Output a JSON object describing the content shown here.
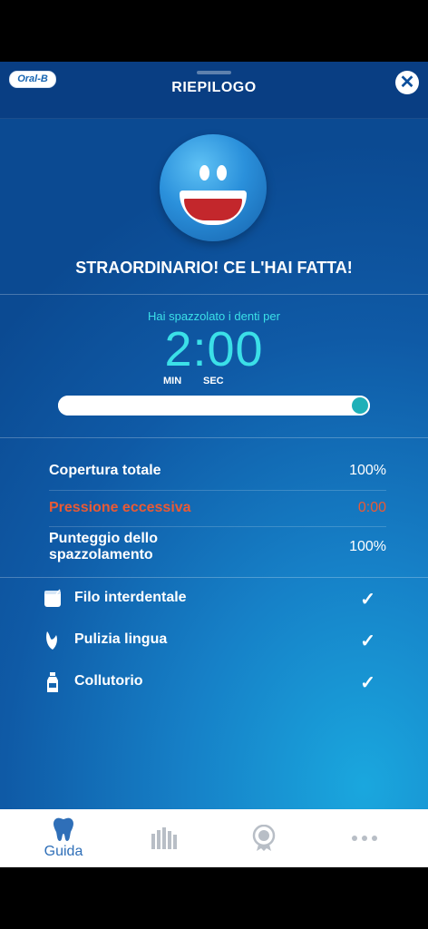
{
  "header": {
    "brand": "Oral-B",
    "title": "RIEPILOGO"
  },
  "headline": "STRAORDINARIO! CE L'HAI FATTA!",
  "timer": {
    "label": "Hai spazzolato i denti per",
    "display": "2:00",
    "min_label": "MIN",
    "sec_label": "SEC",
    "progress": 1.0
  },
  "stats": [
    {
      "label": "Copertura totale",
      "value": "100%",
      "status": "normal"
    },
    {
      "label": "Pressione eccessiva",
      "value": "0:00",
      "status": "warning"
    },
    {
      "label": "Punteggio dello spazzolamento",
      "value": "100%",
      "status": "normal"
    }
  ],
  "tasks": [
    {
      "label": "Filo interdentale",
      "icon": "floss-icon",
      "done": true
    },
    {
      "label": "Pulizia lingua",
      "icon": "tongue-icon",
      "done": true
    },
    {
      "label": "Collutorio",
      "icon": "mouthwash-icon",
      "done": true
    }
  ],
  "tabbar": [
    {
      "label": "Guida",
      "icon": "tooth-icon",
      "active": true
    },
    {
      "label": "",
      "icon": "bar-chart-icon",
      "active": false
    },
    {
      "label": "",
      "icon": "award-icon",
      "active": false
    },
    {
      "label": "",
      "icon": "more-icon",
      "active": false
    }
  ],
  "colors": {
    "accent": "#3be0e8",
    "warning": "#ea5a35",
    "tab_active": "#2f6fb8",
    "tab_inactive": "#b8bec6"
  }
}
